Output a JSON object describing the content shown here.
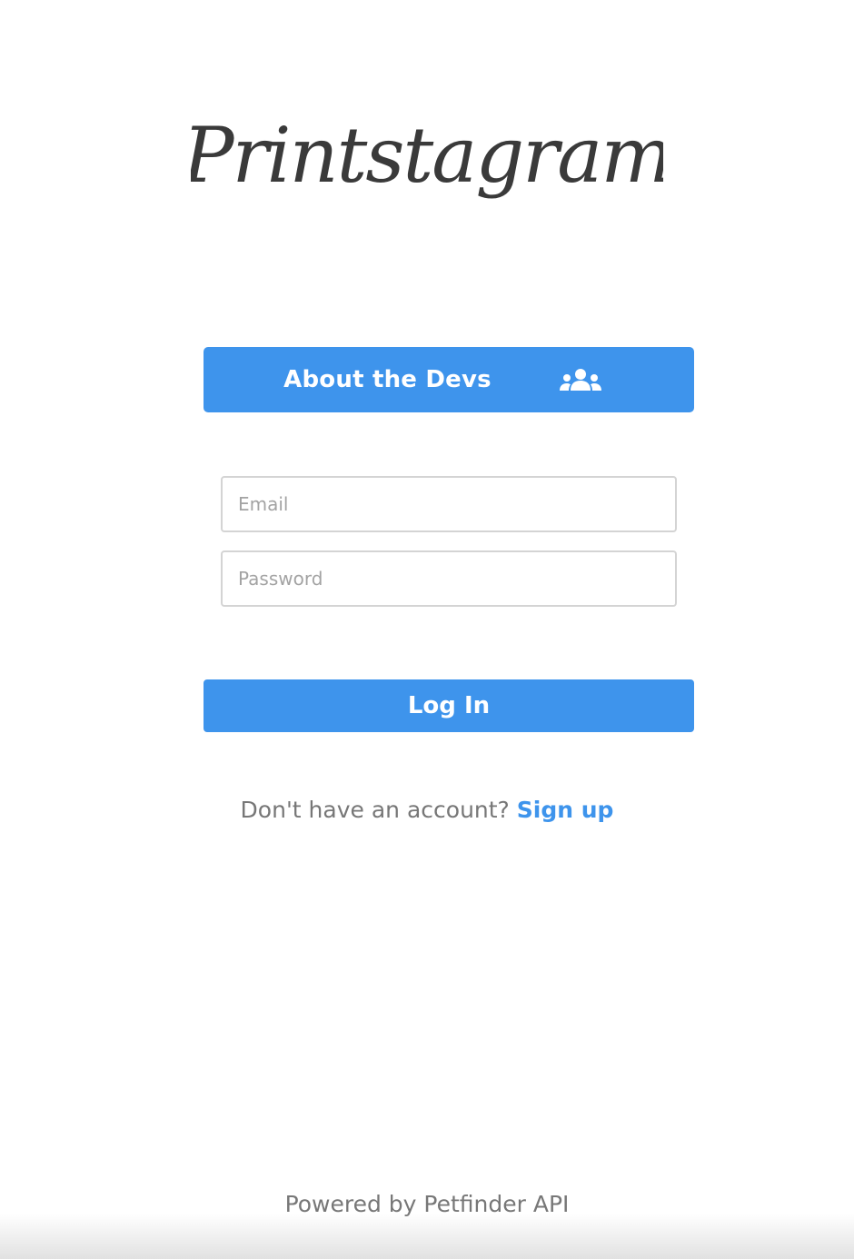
{
  "app": {
    "logo_text": "Printstagram"
  },
  "about_button": {
    "label": "About the Devs",
    "icon": "people-group-icon"
  },
  "login_form": {
    "email_placeholder": "Email",
    "email_value": "",
    "password_placeholder": "Password",
    "password_value": "",
    "submit_label": "Log In"
  },
  "signup": {
    "prompt": "Don't have an account?",
    "link_label": "Sign up"
  },
  "footer": {
    "text": "Powered by Petfinder API"
  },
  "colors": {
    "accent": "#3e94ec",
    "logo_text": "#3a3a3a",
    "muted_text": "#777777",
    "field_border": "#d4d4d4"
  }
}
